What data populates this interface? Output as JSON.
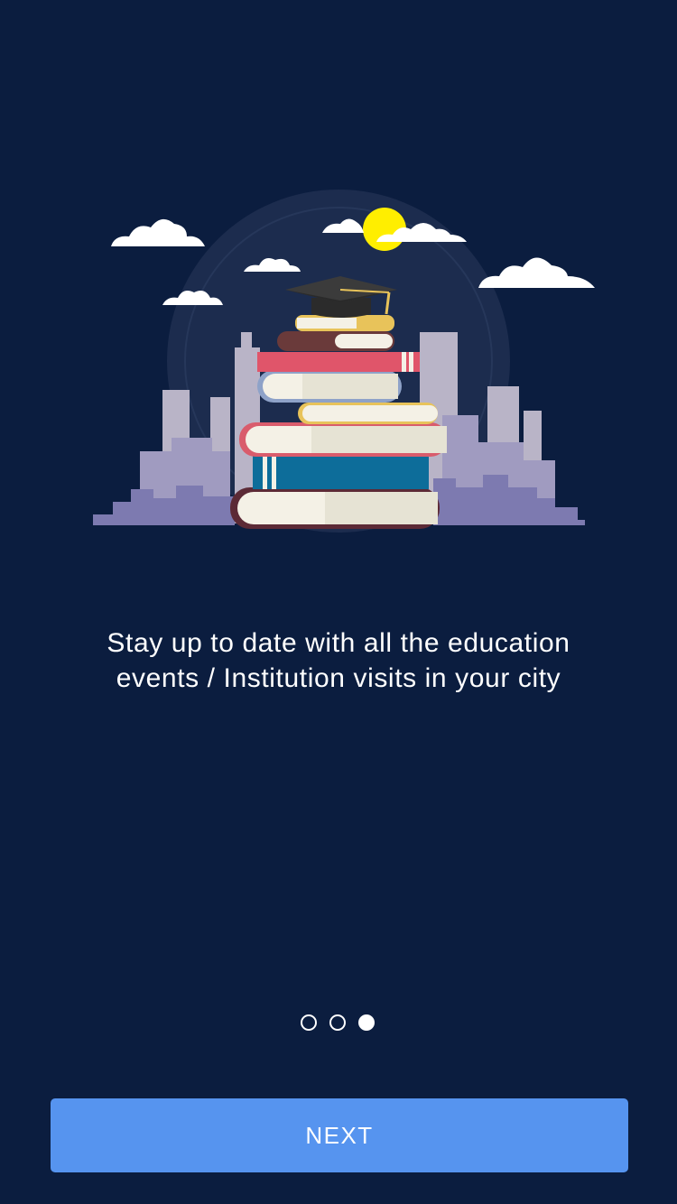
{
  "onboarding": {
    "illustration_icon": "books-graduation-cap-city-illustration",
    "caption_line1": "Stay up to date with all the education",
    "caption_line2": "events / Institution visits in your city",
    "pagination": {
      "total": 3,
      "current": 3
    },
    "next_label": "NEXT"
  },
  "colors": {
    "background": "#0b1d3f",
    "accent": "#5694ef",
    "text": "#ffffff"
  }
}
